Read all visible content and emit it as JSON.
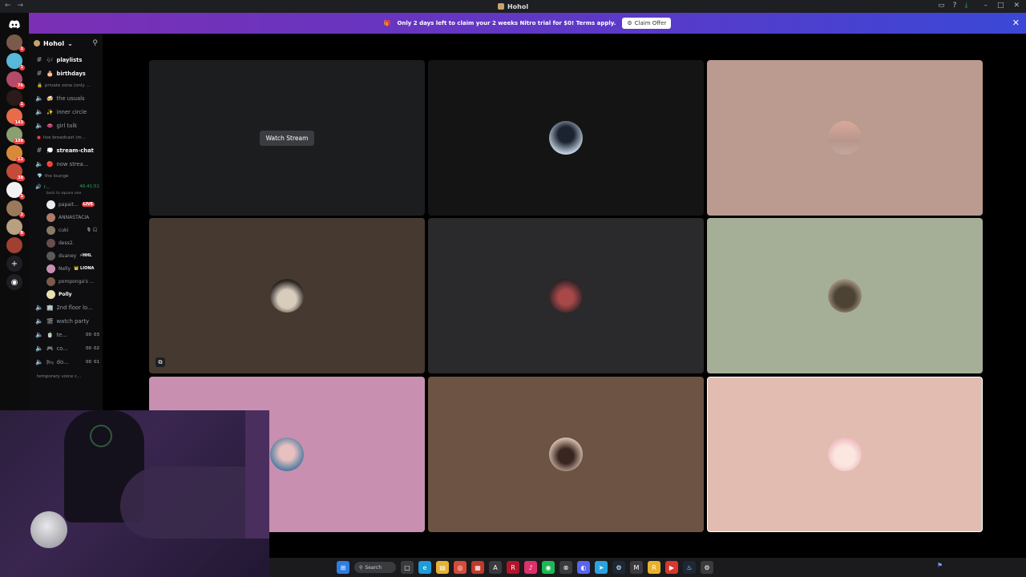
{
  "window": {
    "title": "Hohol",
    "nav_back": "←",
    "nav_forward": "→"
  },
  "banner": {
    "text": "Only 2 days left to claim your 2 weeks Nitro trial for $0! Terms apply.",
    "cta": "Claim Offer",
    "close": "✕"
  },
  "server_rail": {
    "badges": [
      "1",
      "1",
      "76",
      "1",
      "143",
      "188",
      "12",
      "38",
      "1",
      "2",
      "8"
    ]
  },
  "guild": {
    "name": "Hohol",
    "chevron": "⌄"
  },
  "channels": {
    "top": [
      {
        "name": "playlists",
        "emoji": "🎶",
        "type": "text"
      },
      {
        "name": "birthdays",
        "emoji": "🎂",
        "type": "text"
      }
    ],
    "category_private": "private zone (only ...",
    "private": [
      {
        "name": "the usuals",
        "emoji": "🍻"
      },
      {
        "name": "inner circle",
        "emoji": "✨"
      },
      {
        "name": "girl talk",
        "emoji": "👄"
      }
    ],
    "category_live": "live broadcast (m...",
    "live": [
      {
        "name": "stream-chat",
        "emoji": "💭",
        "type": "text",
        "active": true
      },
      {
        "name": "now strea...",
        "emoji": "🔴",
        "type": "voice"
      }
    ],
    "category_lounge": "the lounge",
    "current_voice": {
      "name": "r...",
      "timer": "46:41:51",
      "sub": "back to square one"
    },
    "members": [
      {
        "name": "papait...",
        "tag": "LIVE",
        "color": "#ececec"
      },
      {
        "name": "ANNASTACIA",
        "tag": "",
        "color": "#b07a6a"
      },
      {
        "name": "cuki",
        "tag": "",
        "extra": "🎙 🎧",
        "color": "#8a7a66"
      },
      {
        "name": "dess2.",
        "tag": "",
        "color": "#6b4d4d"
      },
      {
        "name": "duaney",
        "tag": "",
        "extra": "⚡HHL",
        "color": "#5a5a5a"
      },
      {
        "name": "Nelly",
        "tag": "",
        "extra": "👑 LIONA",
        "color": "#c98fb3"
      },
      {
        "name": "pomponga's ...",
        "tag": "",
        "color": "#7a5b4a"
      },
      {
        "name": "Polly",
        "tag": "",
        "color": "#e8e0b0",
        "bright": true
      }
    ],
    "voice_rooms": [
      {
        "name": "2nd floor lo...",
        "emoji": "🏢",
        "counts": []
      },
      {
        "name": "watch party",
        "emoji": "🎬",
        "counts": []
      },
      {
        "name": "te...",
        "emoji": "🍵",
        "counts": [
          "00",
          "03"
        ]
      },
      {
        "name": "co...",
        "emoji": "🎮",
        "counts": [
          "00",
          "02"
        ]
      },
      {
        "name": "do...",
        "emoji": "🛏",
        "counts": [
          "00",
          "01"
        ]
      }
    ],
    "category_temp": "temporary voice c..."
  },
  "grid": {
    "watch_label": "Watch Stream",
    "tiles": [
      {
        "id": "stream-tile",
        "bg": "#1c1d1f",
        "kind": "stream"
      },
      {
        "id": "tile-2",
        "bg": "#141415",
        "avatar": "#c8d8e8"
      },
      {
        "id": "tile-3",
        "bg": "#bb9a90",
        "avatar": "#d9a99a"
      },
      {
        "id": "tile-4",
        "bg": "#46392f",
        "avatar": "#d8cdbd"
      },
      {
        "id": "tile-5",
        "bg": "#2a292b",
        "avatar": "#a84848"
      },
      {
        "id": "tile-6",
        "bg": "#a5af98",
        "avatar": "#4d4335"
      },
      {
        "id": "tile-7",
        "bg": "#c98fb0",
        "avatar": "#4c7aa0"
      },
      {
        "id": "tile-8",
        "bg": "#6d5343",
        "avatar": "#d5bfae"
      },
      {
        "id": "tile-9",
        "bg": "#e2bcb0",
        "avatar": "#f0b8c0",
        "selected": true
      }
    ]
  },
  "taskbar": {
    "search_label": "Search",
    "apps": [
      "start",
      "search",
      "task-view",
      "edge",
      "files",
      "chrome",
      "calendar",
      "adobe",
      "reader",
      "tiktok",
      "spotify",
      "xbox",
      "discord",
      "telegram",
      "steam",
      "epic",
      "app-a",
      "app-b",
      "app-c",
      "settings"
    ]
  },
  "colors": {
    "accent": "#5865f2",
    "live": "#f23f43",
    "voice_green": "#23a55a"
  }
}
